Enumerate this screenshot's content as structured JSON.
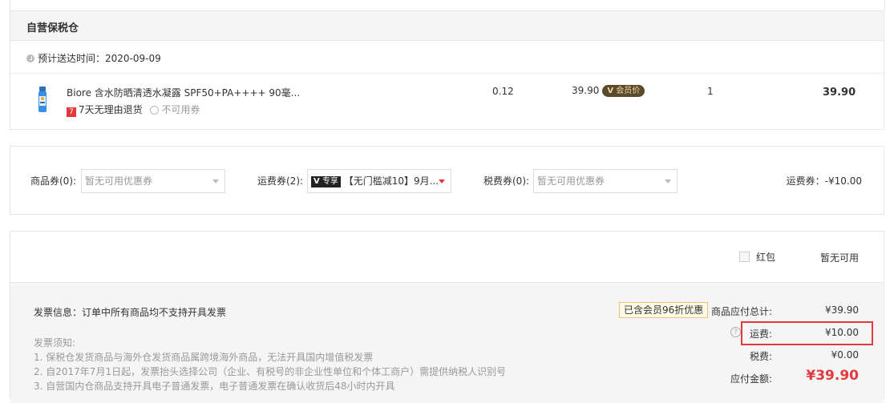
{
  "colors": {
    "accent_red": "#e4393c",
    "border": "#e6e6e6",
    "panel_gray": "#f5f5f5",
    "vip_badge_bg": "#5a4a2e"
  },
  "store": {
    "title": "自营保税仓",
    "delivery_label": "预计送达时间：",
    "delivery_date": "2020-09-09"
  },
  "product": {
    "name": "Biore 含水防晒清透水凝露 SPF50+PA++++ 90毫...",
    "tax": "0.12",
    "price": "39.90",
    "vip_badge": "会员价",
    "quantity": "1",
    "subtotal": "39.90",
    "return_badge": "7",
    "return_text": "7天无理由退货",
    "coupon_note": "不可用券"
  },
  "coupons": {
    "goods_label": "商品券(0):",
    "goods_placeholder": "暂无可用优惠券",
    "shipping_label": "运费券(2):",
    "shipping_tag": "专享",
    "shipping_value": "【无门槛减10】9月...",
    "tax_label": "税费券(0):",
    "tax_placeholder": "暂无可用优惠券",
    "shipping_discount": "运费券：-¥10.00"
  },
  "red_packet": {
    "label": "红包",
    "status": "暂无可用"
  },
  "invoice": {
    "info": "发票信息：订单中所有商品均不支持开具发票",
    "notice_title": "发票须知:",
    "notices": [
      "1. 保税仓发货商品与海外仓发货商品属跨境海外商品，无法开具国内增值税发票",
      "2. 自2017年7月1日起，发票抬头选择公司（企业、有税号的非企业性单位和个体工商户）需提供纳税人识别号",
      "3. 自营国内仓商品支持开具电子普通发票，电子普通发票在确认收货后48小时内开具"
    ]
  },
  "totals": {
    "member_discount": "已含会员96折优惠",
    "goods_total_label": "商品应付总计:",
    "goods_total_value": "¥39.90",
    "shipping_label": "运费:",
    "shipping_value": "¥10.00",
    "tax_label": "税费:",
    "tax_value": "¥0.00",
    "payable_label": "应付金额:",
    "payable_value": "¥39.90"
  }
}
